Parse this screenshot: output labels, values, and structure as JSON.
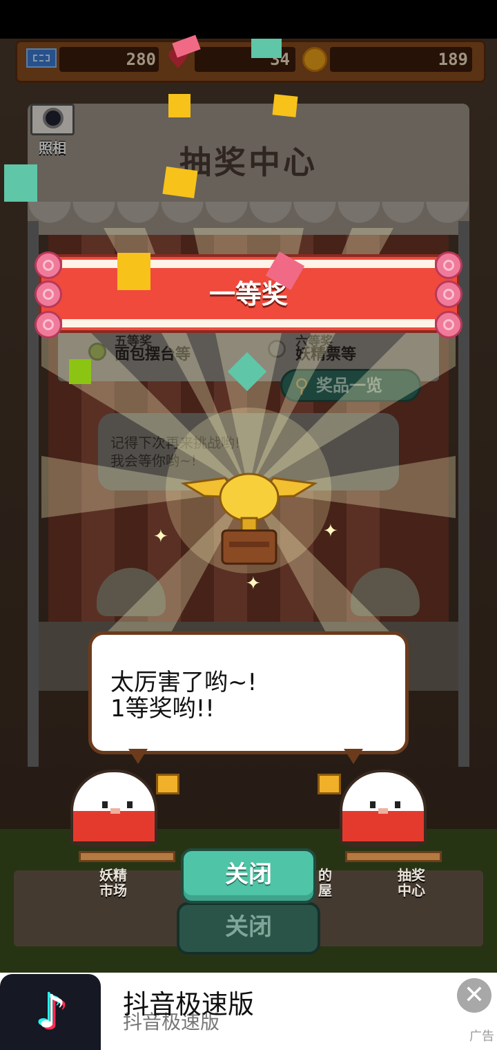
{
  "resources": {
    "tickets": "280",
    "hearts": "34",
    "coins": "189"
  },
  "camera": {
    "label": "照相"
  },
  "booth": {
    "title": "抽奖中心"
  },
  "result_banner": {
    "text": "一等奖"
  },
  "prize_list": {
    "items": [
      {
        "rank": "五等奖",
        "name": "面包摆台等"
      },
      {
        "rank": "六等奖",
        "name": "妖精票等"
      }
    ],
    "button_label": "奖品一览"
  },
  "background_dialog": {
    "line1": "记得下次再来挑战哟!",
    "line2": "我会等你哟~!"
  },
  "speech": {
    "line1": "太厉害了哟~!",
    "line2": "1等奖哟!!"
  },
  "locations": [
    {
      "line1": "妖精",
      "line2": "市场"
    },
    {
      "line1": "的",
      "line2": "屋"
    },
    {
      "line1": "抽奖",
      "line2": "中心"
    }
  ],
  "close_button": {
    "label": "关闭"
  },
  "close_button_ghost": {
    "label": "关闭"
  },
  "ad": {
    "title": "抖音极速版",
    "subtitle": "抖音极速版",
    "tag": "广告",
    "close_icon": "close-icon",
    "logo_icon": "tiktok-note-icon"
  },
  "colors": {
    "banner_red": "#f04a3c",
    "close_button_green": "#4fc4a6",
    "coin_orange": "#f2a71b",
    "heart_red": "#e03040"
  }
}
